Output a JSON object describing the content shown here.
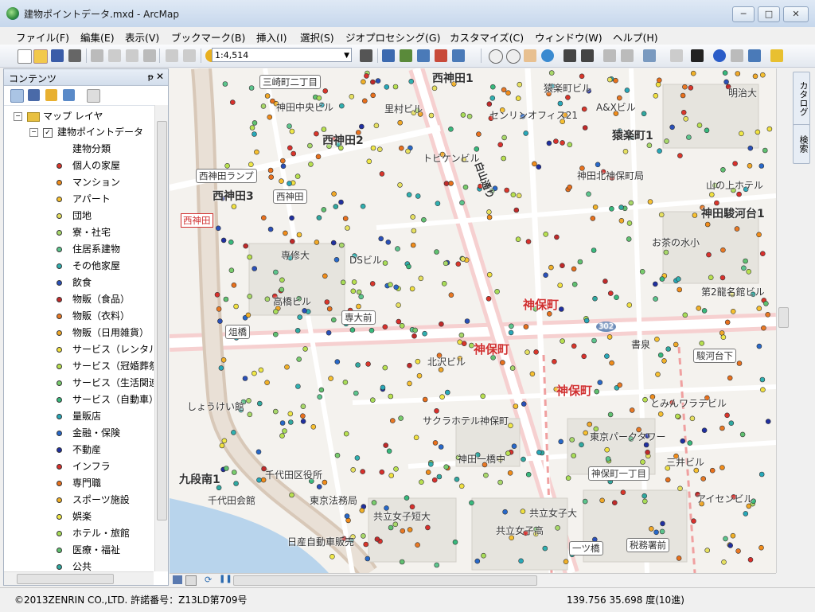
{
  "window": {
    "title": "建物ポイントデータ.mxd - ArcMap",
    "minimize": "─",
    "maximize": "□",
    "close": "✕"
  },
  "menu": [
    "ファイル(F)",
    "編集(E)",
    "表示(V)",
    "ブックマーク(B)",
    "挿入(I)",
    "選択(S)",
    "ジオプロセシング(G)",
    "カスタマイズ(C)",
    "ウィンドウ(W)",
    "ヘルプ(H)"
  ],
  "toolbar": {
    "scale": "1:4,514"
  },
  "toc": {
    "title": "コンテンツ",
    "pin": "ᵽ",
    "close": "✕",
    "root_label": "マップ レイヤ",
    "layer_label": "建物ポイントデータ",
    "field_label": "建物分類",
    "legend": [
      {
        "label": "個人の家屋",
        "color": "#d9362b"
      },
      {
        "label": "マンション",
        "color": "#f08c1a"
      },
      {
        "label": "アパート",
        "color": "#f7c030"
      },
      {
        "label": "団地",
        "color": "#e6e060"
      },
      {
        "label": "寮・社宅",
        "color": "#a8d86a"
      },
      {
        "label": "住居系建物",
        "color": "#5cc48c"
      },
      {
        "label": "その他家屋",
        "color": "#30b0b0"
      },
      {
        "label": "飲食",
        "color": "#2a50b8"
      },
      {
        "label": "物販（食品）",
        "color": "#c02a2a"
      },
      {
        "label": "物販（衣料）",
        "color": "#e87824"
      },
      {
        "label": "物販（日用雑貨）",
        "color": "#f0a828"
      },
      {
        "label": "サービス（レンタル",
        "color": "#f0e040"
      },
      {
        "label": "サービス（冠婚葬祭",
        "color": "#b8e050"
      },
      {
        "label": "サービス（生活関連",
        "color": "#78cc6c"
      },
      {
        "label": "サービス（自動車）",
        "color": "#38b87c"
      },
      {
        "label": "量販店",
        "color": "#28a8b8"
      },
      {
        "label": "金融・保険",
        "color": "#2868c8"
      },
      {
        "label": "不動産",
        "color": "#2030a0"
      },
      {
        "label": "インフラ",
        "color": "#d8302c"
      },
      {
        "label": "専門職",
        "color": "#e8701c"
      },
      {
        "label": "スポーツ施設",
        "color": "#f0b028"
      },
      {
        "label": "娯楽",
        "color": "#f0e848"
      },
      {
        "label": "ホテル・旅館",
        "color": "#a8dc58"
      },
      {
        "label": "医療・福祉",
        "color": "#60c070"
      },
      {
        "label": "公共",
        "color": "#30a8a0"
      }
    ]
  },
  "map_labels": {
    "nishikanda1": "西神田1",
    "sarugaku1": "猿楽町1",
    "nishikanda2": "西神田2",
    "nishikanda3": "西神田3",
    "kandasurugadai1": "神田駿河台1",
    "jimbocho_a": "神保町",
    "jimbocho_b": "神保町",
    "jimbocho_c": "神保町",
    "kudanminami1": "九段南1",
    "misakicho": "三崎町二丁目",
    "nishikanda_lamp": "西神田ランプ",
    "nishikanda_box": "西神田",
    "nishikanda_red": "西神田",
    "sendaimae": "専大前",
    "soba": "俎橋",
    "surugadaishita": "駿河台下",
    "jimbocho1": "神保町一丁目",
    "hitotsubashi": "一ツ橋",
    "zeimusho": "税務署前",
    "hakusan": "白山通り",
    "kandachuo": "神田中央ビル",
    "satomura": "里村ビル",
    "sarugaku_bldg": "猿楽町ビル",
    "ax": "A&Xビル",
    "meiji": "明治大",
    "center21": "センリンオフィス21",
    "tobike": "トビケンビル",
    "kandakita": "神田北神保町局",
    "yamanoue": "山の上ホテル",
    "ochanomizu": "お茶の水小",
    "senshu": "専修大",
    "ds": "DSビル",
    "takahashi": "高橋ビル",
    "dai2meiko": "第2龍名館ビル",
    "kitazawa": "北沢ビル",
    "shosen": "書泉",
    "shoukei": "しょうけい館",
    "sakura": "サクラホテル神保町",
    "tomin": "とみんワラテビル",
    "parktower": "東京パークタワー",
    "mitsui": "三井ビル",
    "kandahitotsubashi": "神田一橋中",
    "chiyodaku": "千代田区役所",
    "chiyodakaikan": "千代田会館",
    "homukyoku": "東京法務局",
    "kyoritsutan": "共立女子短大",
    "kyoritsudai": "共立女子大",
    "kyoritsuko": "共立女子高",
    "nissan": "日産自動車販売",
    "iseki": "アイセンビル",
    "r302": "302"
  },
  "statusbar": {
    "copyright": "©2013ZENRIN CO.,LTD. 許諾番号：Z13LD第709号",
    "coords": "139.756  35.698 度(10進)"
  },
  "dock": {
    "catalog": "カタログ",
    "search": "検索"
  }
}
